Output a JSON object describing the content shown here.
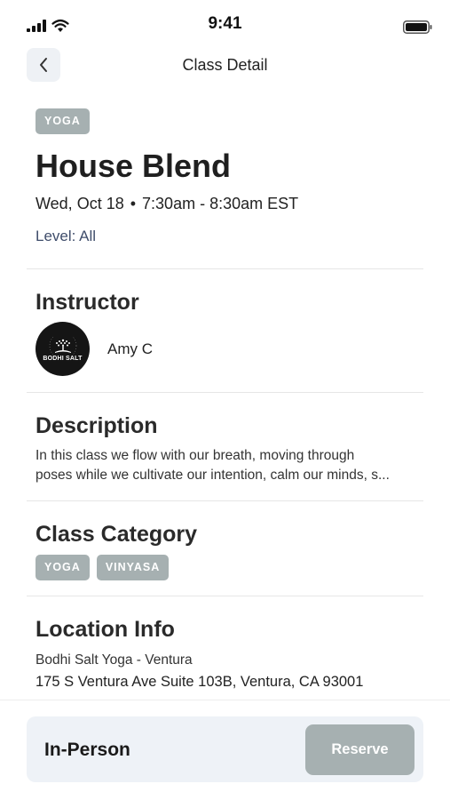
{
  "status_bar": {
    "time": "9:41",
    "icons": [
      "signal-icon",
      "wifi-icon",
      "battery-icon"
    ]
  },
  "header": {
    "back_icon": "chevron-left-icon",
    "title": "Class Detail"
  },
  "class": {
    "tag": "YOGA",
    "title": "House Blend",
    "date": "Wed, Oct 18",
    "separator": "•",
    "time": "7:30am - 8:30am EST",
    "level": "Level: All"
  },
  "instructor": {
    "heading": "Instructor",
    "avatar_text": "BODHI SALT",
    "name": "Amy C"
  },
  "description": {
    "heading": "Description",
    "line1": "In this class we flow with our breath, moving through",
    "line2": "poses while we cultivate our intention, calm our minds, s..."
  },
  "category": {
    "heading": "Class Category",
    "tags": [
      "YOGA",
      "VINYASA"
    ]
  },
  "location": {
    "heading": "Location Info",
    "name": "Bodhi Salt Yoga - Ventura",
    "address": "175 S Ventura Ave Suite 103B, Ventura, CA 93001"
  },
  "footer": {
    "mode": "In-Person",
    "reserve_label": "Reserve"
  },
  "colors": {
    "tag_bg": "#a6b0b1",
    "level_text": "#3f4d6b",
    "footer_bg": "#eef2f7",
    "avatar_bg": "#151515"
  }
}
